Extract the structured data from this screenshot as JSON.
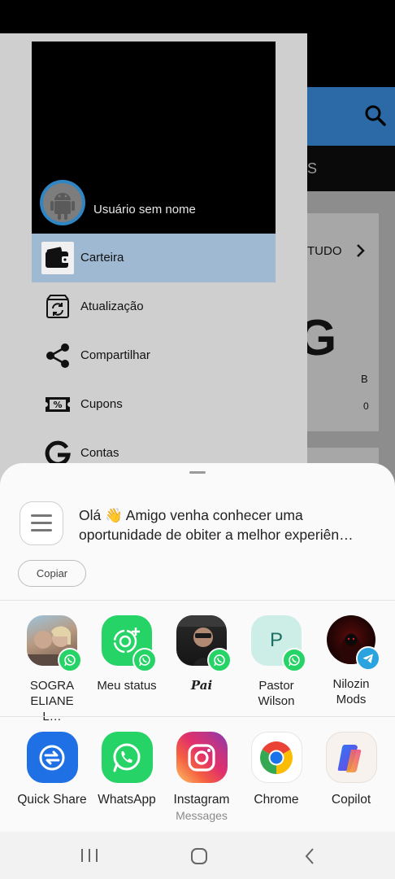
{
  "background_app": {
    "tab_fragment": "S",
    "card_fragment": "TUDO",
    "card_letter": "G",
    "card_b": "B",
    "card_zero": "0"
  },
  "drawer": {
    "user_name": "Usuário sem nome",
    "items": [
      {
        "label": "Carteira",
        "icon": "wallet-icon",
        "selected": true
      },
      {
        "label": "Atualização",
        "icon": "update-icon",
        "selected": false
      },
      {
        "label": "Compartilhar",
        "icon": "share-icon",
        "selected": false
      },
      {
        "label": "Cupons",
        "icon": "coupon-icon",
        "selected": false
      },
      {
        "label": "Contas",
        "icon": "google-g-icon",
        "selected": false
      }
    ]
  },
  "share_sheet": {
    "message_line1": "Olá 👋 Amigo venha conhecer uma",
    "message_line2": "oportunidade de obiter a melhor experiên…",
    "copy_label": "Copiar",
    "contacts": [
      {
        "name": "SOGRA ELIANE L…",
        "badge": "whatsapp"
      },
      {
        "name": "Meu status",
        "badge": "whatsapp"
      },
      {
        "name": "Pai",
        "badge": "whatsapp"
      },
      {
        "name": "Pastor Wilson",
        "initial": "P",
        "badge": "whatsapp"
      },
      {
        "name": "Nilozin Mods",
        "badge": "telegram"
      }
    ],
    "apps": [
      {
        "name": "Quick Share",
        "sub": ""
      },
      {
        "name": "WhatsApp",
        "sub": ""
      },
      {
        "name": "Instagram",
        "sub": "Messages"
      },
      {
        "name": "Chrome",
        "sub": ""
      },
      {
        "name": "Copilot",
        "sub": ""
      }
    ]
  },
  "colors": {
    "drawer_bg": "#cfcfcf",
    "selected_item": "#9fb9d3",
    "toolbar_blue": "#2b6aa6",
    "whatsapp_green": "#25d366",
    "telegram_blue": "#2aa3df"
  }
}
